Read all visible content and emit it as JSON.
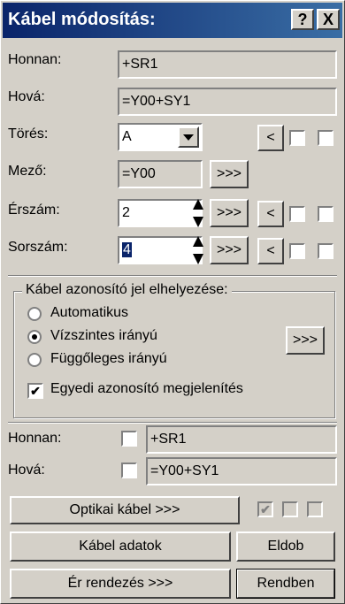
{
  "window": {
    "title": "Kábel módosítás:",
    "help_label": "?",
    "close_label": "X"
  },
  "fields": {
    "honnan": {
      "label": "Honnan:",
      "value": "+SR1"
    },
    "hova": {
      "label": "Hová:",
      "value": "=Y00+SY1"
    },
    "tores": {
      "label": "Törés:",
      "value": "A"
    },
    "mezo": {
      "label": "Mező:",
      "value": "=Y00",
      "btn": ">>>"
    },
    "erszam": {
      "label": "Érszám:",
      "value": "2",
      "btn": ">>>"
    },
    "sorszam": {
      "label": "Sorszám:",
      "value": "4",
      "btn": ">>>"
    },
    "back_label": "<"
  },
  "placement": {
    "title": "Kábel azonosító jel elhelyezése:",
    "options": [
      "Automatikus",
      "Vízszintes irányú",
      "Függőleges irányú"
    ],
    "selected_index": 1,
    "more_btn": ">>>",
    "unique_label": "Egyedi azonosító megjelenítés",
    "unique_checked": true
  },
  "bottom": {
    "honnan": {
      "label": "Honnan:",
      "value": "+SR1"
    },
    "hova": {
      "label": "Hová:",
      "value": "=Y00+SY1"
    }
  },
  "buttons": {
    "optical": "Optikai kábel >>>",
    "cable_data": "Kábel adatok",
    "discard": "Eldob",
    "wire_order": "Ér rendezés >>>",
    "ok": "Rendben"
  },
  "icons": {
    "checkmark": "✔"
  }
}
